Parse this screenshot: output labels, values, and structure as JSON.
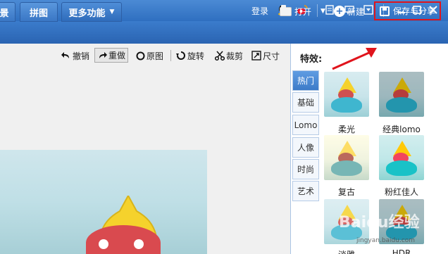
{
  "titlebar": {
    "login": "登录"
  },
  "nav": {
    "tab_scene": "景",
    "tab_collage": "拼图",
    "tab_more": "更多功能",
    "open": "打开",
    "new": "新建",
    "save_share": "保存与分享"
  },
  "toolbar": {
    "undo": "撤销",
    "redo": "重做",
    "original": "原图",
    "rotate": "旋转",
    "crop": "裁剪",
    "size": "尺寸"
  },
  "panel": {
    "title": "特效:",
    "tabs": [
      "热门",
      "基础",
      "Lomo",
      "人像",
      "时尚",
      "艺术"
    ],
    "effects": [
      "柔光",
      "经典lomo",
      "复古",
      "粉红佳人",
      "淡雅",
      "HDR"
    ]
  },
  "watermark": {
    "text": "Baidu经验",
    "url": "jingyan.baidu.com"
  },
  "colors": {
    "accent": "#2f6fc0",
    "highlight": "#e0141c"
  }
}
